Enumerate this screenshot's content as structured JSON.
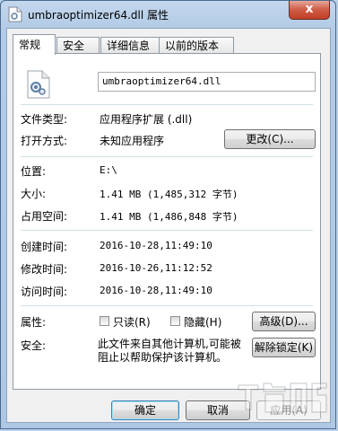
{
  "window": {
    "title": "umbraoptimizer64.dll 属性",
    "close_label": "x"
  },
  "tabs": [
    {
      "label": "常规",
      "active": true
    },
    {
      "label": "安全",
      "active": false
    },
    {
      "label": "详细信息",
      "active": false
    },
    {
      "label": "以前的版本",
      "active": false
    }
  ],
  "general": {
    "file_name": "umbraoptimizer64.dll",
    "file_type_label": "文件类型:",
    "file_type_value": "应用程序扩展 (.dll)",
    "opens_with_label": "打开方式:",
    "opens_with_value": "未知应用程序",
    "change_button": "更改(C)...",
    "location_label": "位置:",
    "location_value": "E:\\",
    "size_label": "大小:",
    "size_value": "1.41 MB (1,485,312 字节)",
    "size_on_disk_label": "占用空间:",
    "size_on_disk_value": "1.41 MB (1,486,848 字节)",
    "created_label": "创建时间:",
    "created_value": "2016-10-28,11:49:10",
    "modified_label": "修改时间:",
    "modified_value": "2016-10-26,11:12:52",
    "accessed_label": "访问时间:",
    "accessed_value": "2016-10-28,11:49:10",
    "attributes_label": "属性:",
    "readonly_label": "只读(R)",
    "readonly_checked": false,
    "hidden_label": "隐藏(H)",
    "hidden_checked": false,
    "advanced_button": "高级(D)...",
    "security_label": "安全:",
    "security_text": "此文件来自其他计算机,可能被阻止以帮助保护该计算机。",
    "unblock_button": "解除锁定(K)"
  },
  "footer": {
    "ok": "确定",
    "cancel": "取消",
    "apply": "应用(A)"
  },
  "colors": {
    "title_bar": "#b9d1ea",
    "close_button": "#c94a33",
    "dialog_bg": "#f0f0f0"
  }
}
